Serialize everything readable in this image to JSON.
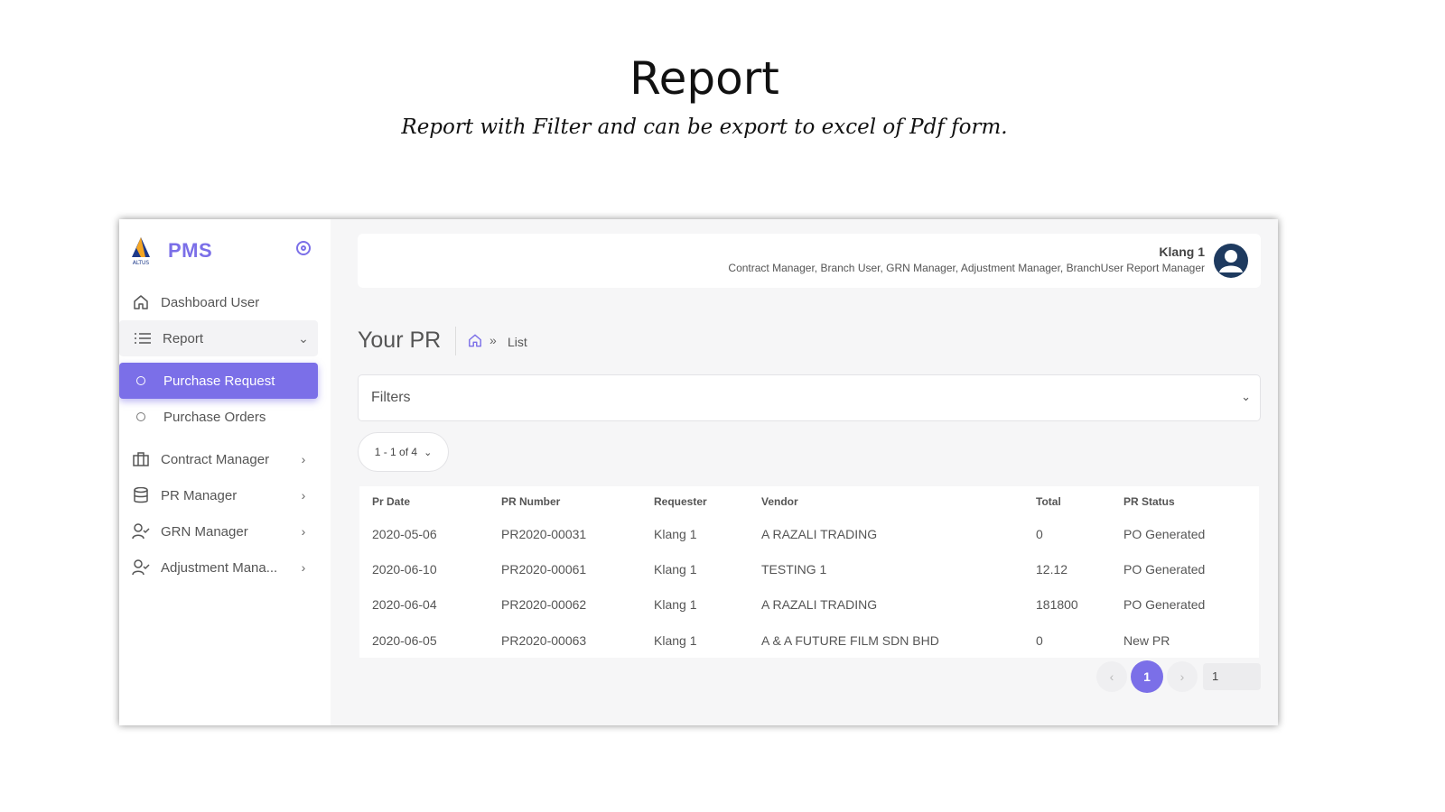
{
  "slide": {
    "title": "Report",
    "subtitle": "Report with Filter and can be export to excel of Pdf form."
  },
  "brand": {
    "logo_text": "ALTUS",
    "name": "PMS"
  },
  "sidebar": {
    "items": [
      {
        "label": "Dashboard User",
        "icon": "home-icon"
      },
      {
        "label": "Report",
        "icon": "list-icon",
        "expanded": true
      },
      {
        "label": "Purchase Request",
        "icon": "circle-icon",
        "active": true
      },
      {
        "label": "Purchase Orders",
        "icon": "circle-icon"
      },
      {
        "label": "Contract Manager",
        "icon": "briefcase-icon"
      },
      {
        "label": "PR Manager",
        "icon": "database-icon"
      },
      {
        "label": "GRN Manager",
        "icon": "user-check-icon"
      },
      {
        "label": "Adjustment Mana...",
        "icon": "user-check-icon"
      }
    ]
  },
  "user": {
    "name": "Klang 1",
    "roles": "Contract Manager, Branch User, GRN Manager, Adjustment Manager, BranchUser Report Manager"
  },
  "page": {
    "title": "Your PR",
    "breadcrumb_current": "List",
    "breadcrumb_sep": "»"
  },
  "filters": {
    "label": "Filters"
  },
  "pagination": {
    "summary": "1 - 1 of 4",
    "current_page": "1",
    "page_input": "1",
    "colors": {
      "accent": "#7b6fe8"
    }
  },
  "table": {
    "columns": [
      "Pr Date",
      "PR Number",
      "Requester",
      "Vendor",
      "Total",
      "PR Status"
    ],
    "rows": [
      [
        "2020-05-06",
        "PR2020-00031",
        "Klang 1",
        "A RAZALI TRADING",
        "0",
        "PO Generated"
      ],
      [
        "2020-06-10",
        "PR2020-00061",
        "Klang 1",
        "TESTING 1",
        "12.12",
        "PO Generated"
      ],
      [
        "2020-06-04",
        "PR2020-00062",
        "Klang 1",
        "A RAZALI TRADING",
        "181800",
        "PO Generated"
      ],
      [
        "2020-06-05",
        "PR2020-00063",
        "Klang 1",
        "A & A FUTURE FILM SDN BHD",
        "0",
        "New PR"
      ]
    ]
  }
}
